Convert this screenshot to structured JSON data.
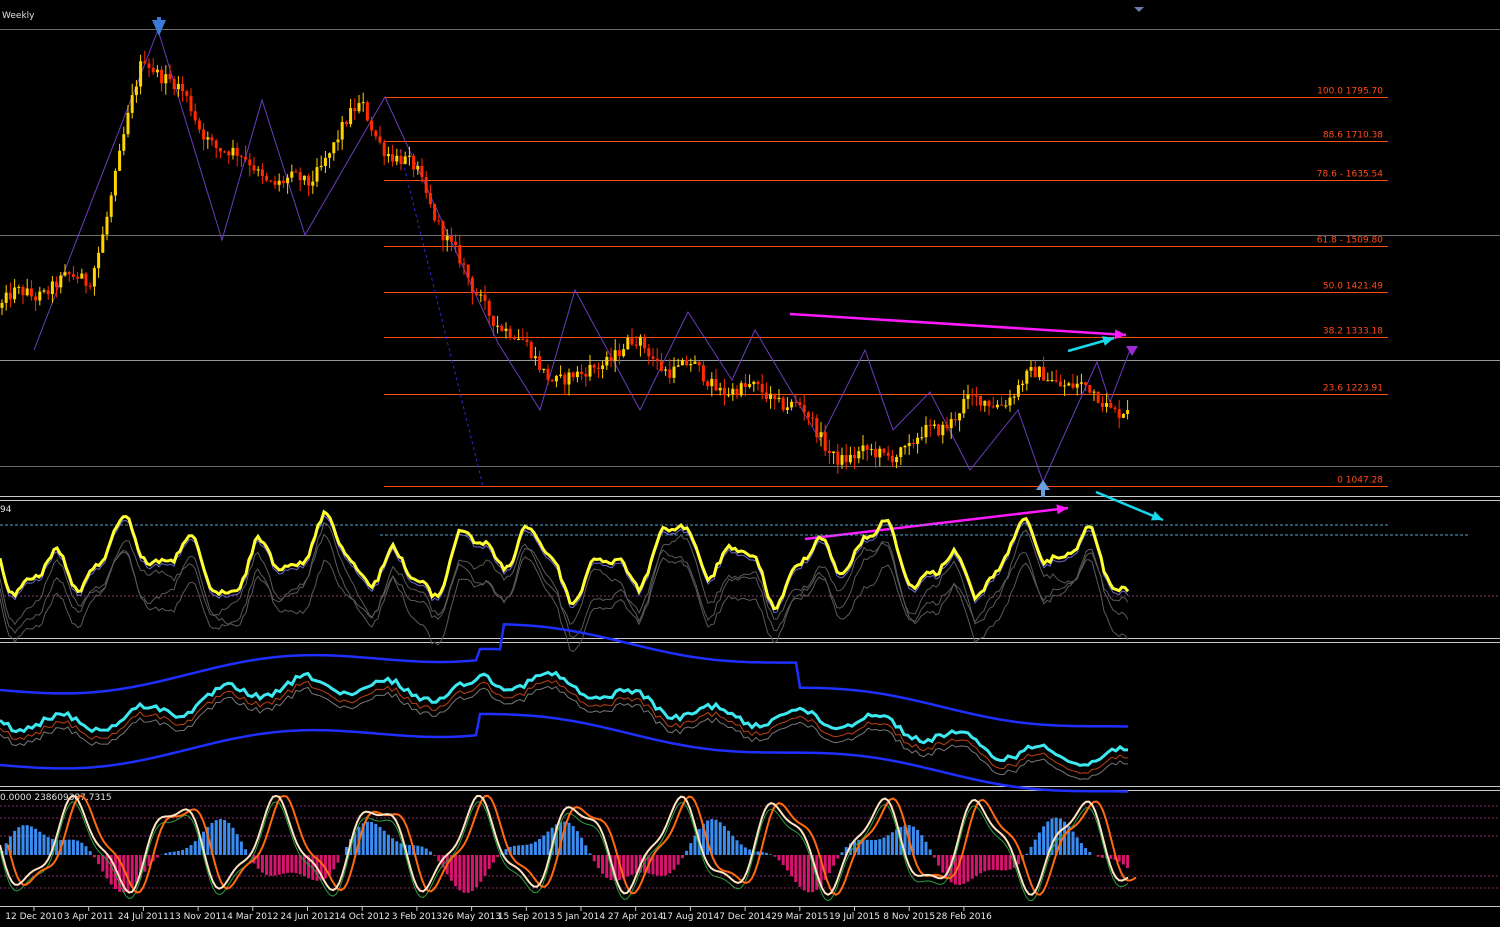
{
  "timeframe_label": "Weekly",
  "indicator1_value": "94",
  "indicator3_value": "0.0000 238609387.7315",
  "colors": {
    "background": "#000000",
    "bull_candle": "#ffd400",
    "bear_candle": "#ff2a00",
    "fib_line": "#ff4a1a",
    "pane_border": "#c8c8c8",
    "magenta_arrow": "#ff1aff",
    "cyan_arrow": "#18d8ee",
    "oscillator": "#ffff33",
    "cyan_line": "#3ee8f0",
    "blue_band": "#1f2fff",
    "hist_pos": "#3a8cf0",
    "hist_neg": "#d6156e",
    "stoch_main": "#ffe4c4",
    "stoch_signal": "#ff6a10"
  },
  "date_labels": [
    "12 Dec 2010",
    "3 Apr 2011",
    "24 Jul 2011",
    "13 Nov 2011",
    "4 Mar 2012",
    "24 Jun 2012",
    "14 Oct 2012",
    "3 Feb 2013",
    "26 May 2013",
    "15 Sep 2013",
    "5 Jan 2014",
    "27 Apr 2014",
    "17 Aug 2014",
    "7 Dec 2014",
    "29 Mar 2015",
    "19 Jul 2015",
    "8 Nov 2015",
    "28 Feb 2016"
  ],
  "chart_data": {
    "type": "candlestick",
    "timeframe": "Weekly",
    "x_ticks": [
      "12 Dec 2010",
      "3 Apr 2011",
      "24 Jul 2011",
      "13 Nov 2011",
      "4 Mar 2012",
      "24 Jun 2012",
      "14 Oct 2012",
      "3 Feb 2013",
      "26 May 2013",
      "15 Sep 2013",
      "5 Jan 2014",
      "27 Apr 2014",
      "17 Aug 2014",
      "7 Dec 2014",
      "29 Mar 2015",
      "19 Jul 2015",
      "8 Nov 2015",
      "28 Feb 2016"
    ],
    "fibonacci_levels": [
      {
        "label": "100.0 1795.70",
        "ratio": 100.0,
        "price": 1795.7
      },
      {
        "label": "88.6 1710.38",
        "ratio": 88.6,
        "price": 1710.38
      },
      {
        "label": "78.6 - 1635.54",
        "ratio": 78.6,
        "price": 1635.54
      },
      {
        "label": "61.8 - 1509.80",
        "ratio": 61.8,
        "price": 1509.8
      },
      {
        "label": "50.0 1421.49",
        "ratio": 50.0,
        "price": 1421.49
      },
      {
        "label": "38.2 1333.18",
        "ratio": 38.2,
        "price": 1333.18
      },
      {
        "label": "23.6 1223.91",
        "ratio": 23.6,
        "price": 1223.91
      },
      {
        "label": "0 1047.28",
        "ratio": 0,
        "price": 1047.28
      }
    ],
    "approx_close_path": [
      {
        "date": "12 Dec 2010",
        "price": 1390
      },
      {
        "date": "3 Apr 2011",
        "price": 1460
      },
      {
        "date": "24 Jul 2011",
        "price": 1880
      },
      {
        "date": "13 Nov 2011",
        "price": 1720
      },
      {
        "date": "4 Mar 2012",
        "price": 1690
      },
      {
        "date": "24 Jun 2012",
        "price": 1600
      },
      {
        "date": "14 Oct 2012",
        "price": 1775
      },
      {
        "date": "3 Feb 2013",
        "price": 1665
      },
      {
        "date": "26 May 2013",
        "price": 1390
      },
      {
        "date": "15 Sep 2013",
        "price": 1330
      },
      {
        "date": "5 Jan 2014",
        "price": 1245
      },
      {
        "date": "27 Apr 2014",
        "price": 1300
      },
      {
        "date": "17 Aug 2014",
        "price": 1300
      },
      {
        "date": "7 Dec 2014",
        "price": 1200
      },
      {
        "date": "29 Mar 2015",
        "price": 1200
      },
      {
        "date": "19 Jul 2015",
        "price": 1110
      },
      {
        "date": "8 Nov 2015",
        "price": 1085
      },
      {
        "date": "28 Feb 2016",
        "price": 1230
      }
    ]
  }
}
